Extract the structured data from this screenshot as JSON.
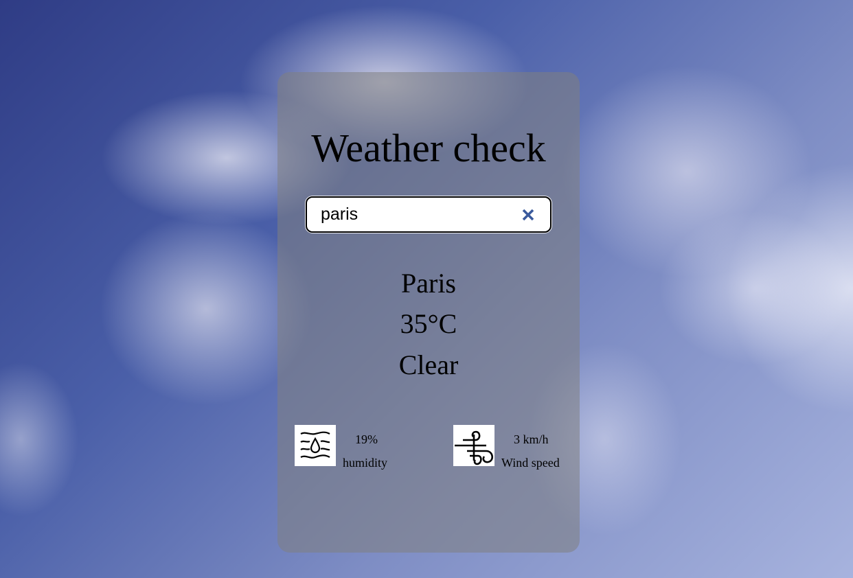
{
  "app": {
    "title": "Weather check"
  },
  "search": {
    "value": "paris",
    "clear_icon": "close-icon",
    "clear_color": "#3a5a9c"
  },
  "weather": {
    "city": "Paris",
    "temperature": "35°C",
    "condition": "Clear"
  },
  "details": {
    "humidity": {
      "icon": "humidity-icon",
      "value": "19%",
      "label": "humidity"
    },
    "wind": {
      "icon": "wind-icon",
      "value": "3 km/h",
      "label": "Wind speed"
    }
  }
}
